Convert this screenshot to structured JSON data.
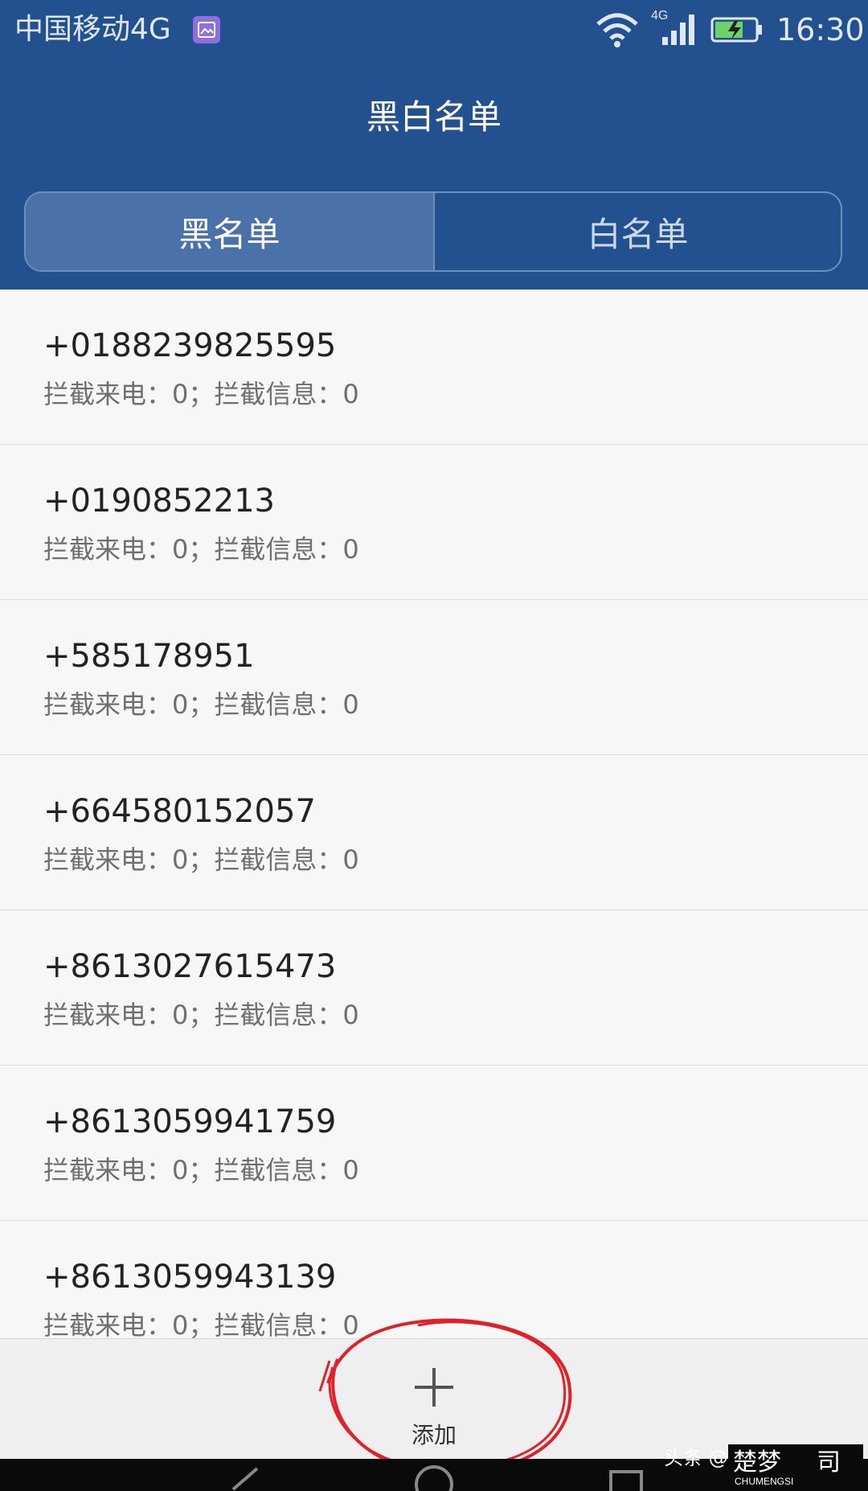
{
  "status_bar": {
    "carrier": "中国移动4G",
    "network_type": "4G",
    "time": "16:30",
    "icons": [
      "gallery-notification-icon",
      "wifi-icon",
      "signal-icon",
      "battery-charging-icon"
    ]
  },
  "app_bar": {
    "title": "黑白名单"
  },
  "tabs": [
    {
      "label": "黑名单",
      "selected": true
    },
    {
      "label": "白名单",
      "selected": false
    }
  ],
  "list": {
    "items": [
      {
        "number": "+0188239825595",
        "stats": "拦截来电：0；拦截信息：0"
      },
      {
        "number": "+0190852213",
        "stats": "拦截来电：0；拦截信息：0"
      },
      {
        "number": "+585178951",
        "stats": "拦截来电：0；拦截信息：0"
      },
      {
        "number": "+664580152057",
        "stats": "拦截来电：0；拦截信息：0"
      },
      {
        "number": "+8613027615473",
        "stats": "拦截来电：0；拦截信息：0"
      },
      {
        "number": "+8613059941759",
        "stats": "拦截来电：0；拦截信息：0"
      },
      {
        "number": "+8613059943139",
        "stats": "拦截来电：0；拦截信息：0"
      }
    ]
  },
  "bottom_bar": {
    "add_label": "添加",
    "add_icon": "plus-icon"
  },
  "watermark": {
    "source": "头条 @"
  },
  "colors": {
    "primary": "#23508f",
    "selected_tab": "#4b72a8",
    "background": "#f7f7f7",
    "annotation_red": "#e0202a"
  }
}
